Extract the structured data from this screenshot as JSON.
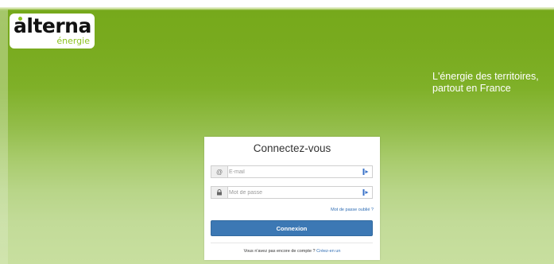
{
  "logo": {
    "brand": "alterna",
    "sub": "énergie"
  },
  "tagline": {
    "line1": "L'énergie des territoires,",
    "line2": "partout en France"
  },
  "login": {
    "title": "Connectez-vous",
    "email": {
      "value": "",
      "placeholder": "E-mail",
      "icon": "at-icon"
    },
    "password": {
      "value": "",
      "placeholder": "Mot de passe",
      "icon": "lock-icon"
    },
    "forgot_link": "Mot de passe oublié ?",
    "submit_label": "Connexion",
    "signup_text": "Vous n'avez pas encore de compte ?",
    "signup_link": "Créez-en un"
  },
  "colors": {
    "brand_green": "#8cc21f",
    "hero_green": "#76a91b",
    "button_blue": "#3c78b4",
    "link_blue": "#2f6db4"
  }
}
